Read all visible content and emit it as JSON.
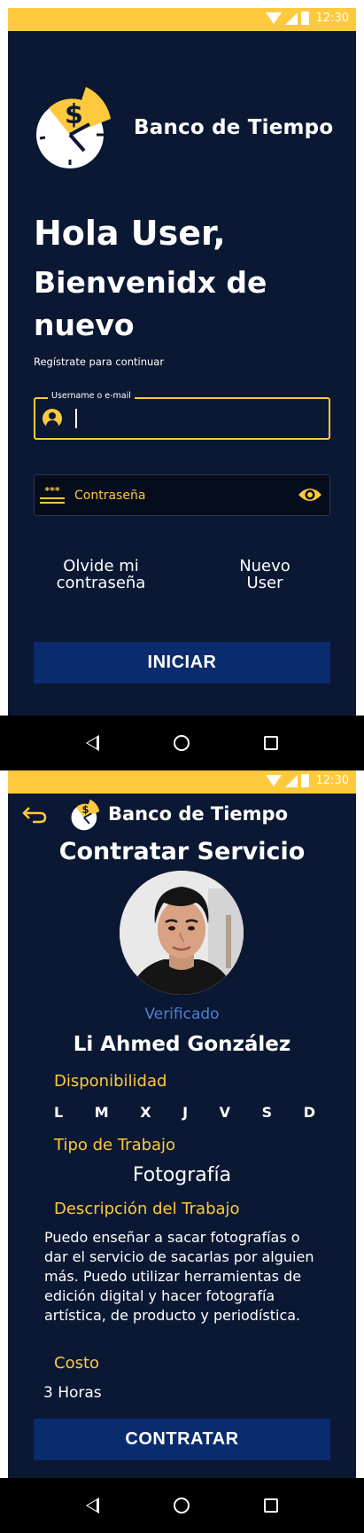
{
  "status_bar": {
    "time": "12:30"
  },
  "login": {
    "brand": "Banco de Tiempo",
    "greeting": "Hola User,",
    "welcome": "Bienvenidx de nuevo",
    "subtitle": "Regístrate para continuar",
    "username": {
      "label": "Username o e-mail",
      "value": "",
      "placeholder": ""
    },
    "password": {
      "placeholder": "Contraseña"
    },
    "forgot_link": "Olvide mi contraseña",
    "new_user_link": "Nuevo User",
    "submit_label": "INICIAR"
  },
  "service": {
    "brand": "Banco de Tiempo",
    "title": "Contratar Servicio",
    "verified_label": "Verificado",
    "provider_name": "Li Ahmed González",
    "availability_label": "Disponibilidad",
    "days": [
      "L",
      "M",
      "X",
      "J",
      "V",
      "S",
      "D"
    ],
    "job_type_label": "Tipo de Trabajo",
    "job_type": "Fotografía",
    "description_label": "Descripción del Trabajo",
    "description": "Puedo enseñar a sacar fotografías o dar el servicio de sacarlas  por alguien más. Puedo utilizar herramientas de edición digital y hacer fotografía artística, de producto y periodística.",
    "cost_label": "Costo",
    "cost": "3 Horas",
    "submit_label": "CONTRATAR"
  },
  "icons": {
    "logo": "clock-dollar-logo-icon",
    "user": "user-circle-icon",
    "password": "password-asterisk-icon",
    "eye": "eye-icon",
    "back": "back-arrow-icon"
  },
  "colors": {
    "background": "#0b1833",
    "accent": "#ffc93e",
    "button": "#0a2b6e",
    "verified": "#4d7fd6"
  }
}
